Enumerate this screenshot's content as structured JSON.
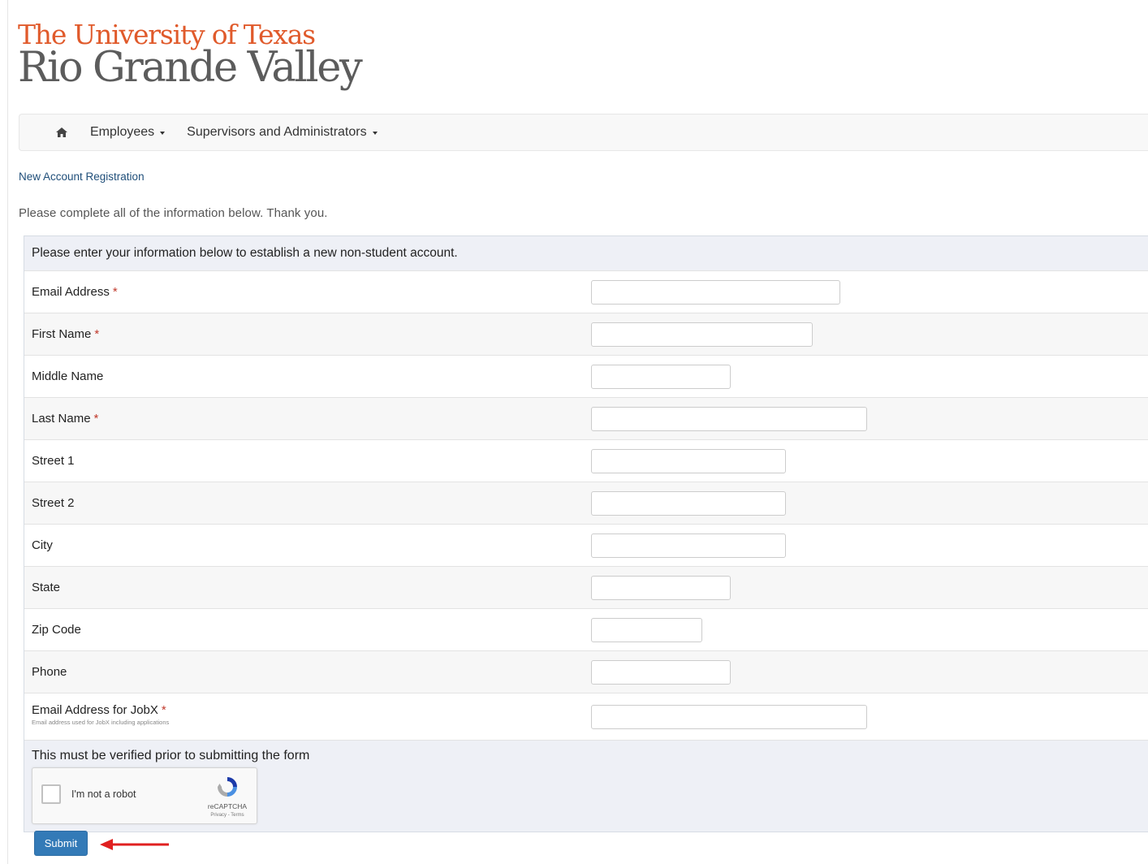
{
  "brand": {
    "line1": "The University of Texas",
    "line2": "Rio Grande Valley",
    "line1_color": "#e05a2b",
    "line2_color": "#5c5c5c"
  },
  "nav": {
    "home_icon": "home-icon",
    "items": [
      {
        "label": "Employees"
      },
      {
        "label": "Supervisors and Administrators"
      }
    ]
  },
  "breadcrumb": "New Account Registration",
  "intro": "Please complete all of the information below. Thank you.",
  "form": {
    "heading": "Please enter your information below to establish a new non-student account.",
    "fields": [
      {
        "label": "Email Address",
        "required": true,
        "value": ""
      },
      {
        "label": "First Name",
        "required": true,
        "value": ""
      },
      {
        "label": "Middle Name",
        "required": false,
        "value": ""
      },
      {
        "label": "Last Name",
        "required": true,
        "value": ""
      },
      {
        "label": "Street 1",
        "required": false,
        "value": ""
      },
      {
        "label": "Street 2",
        "required": false,
        "value": ""
      },
      {
        "label": "City",
        "required": false,
        "value": ""
      },
      {
        "label": "State",
        "required": false,
        "value": ""
      },
      {
        "label": "Zip Code",
        "required": false,
        "value": ""
      },
      {
        "label": "Phone",
        "required": false,
        "value": ""
      },
      {
        "label": "Email Address for JobX",
        "required": true,
        "hint": "Email address used for JobX including applications",
        "value": ""
      }
    ],
    "required_marker": "*",
    "verify_title": "This must be verified prior to submitting the form",
    "captcha": {
      "label": "I'm not a robot",
      "brand": "reCAPTCHA",
      "terms": "Privacy - Terms"
    },
    "submit_label": "Submit",
    "accent_color": "#337ab7",
    "arrow_color": "#e02020"
  }
}
